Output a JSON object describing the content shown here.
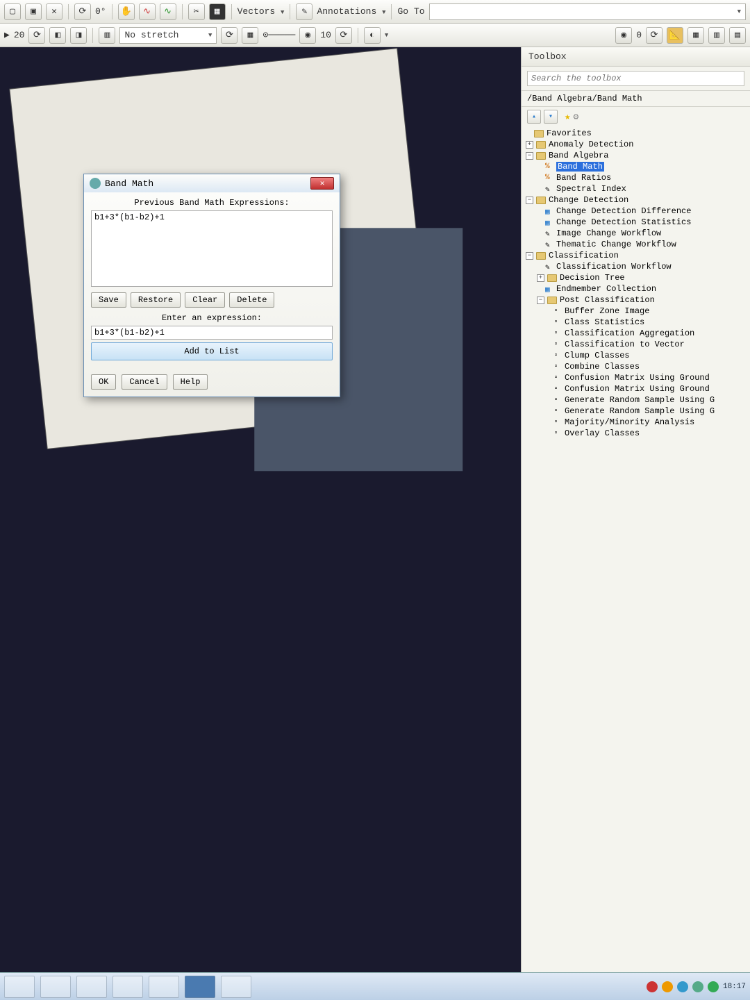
{
  "toolbar": {
    "rotation": "0°",
    "vectors": "Vectors",
    "annotations": "Annotations",
    "goto": "Go To",
    "zoom20": "20",
    "stretch": "No stretch",
    "value10": "10",
    "value0": "0"
  },
  "dialog": {
    "title": "Band Math",
    "label_prev": "Previous Band Math Expressions:",
    "expr_prev": "b1+3*(b1-b2)+1",
    "save": "Save",
    "restore": "Restore",
    "clear": "Clear",
    "delete": "Delete",
    "label_enter": "Enter an expression:",
    "expr_input": "b1+3*(b1-b2)+1",
    "add": "Add to List",
    "ok": "OK",
    "cancel": "Cancel",
    "help": "Help"
  },
  "sidebar": {
    "title": "Toolbox",
    "search_placeholder": "Search the toolbox",
    "path": "/Band Algebra/Band Math",
    "favorites": "Favorites",
    "anomaly": "Anomaly Detection",
    "band_algebra": "Band Algebra",
    "band_math": "Band Math",
    "band_ratios": "Band Ratios",
    "spectral_index": "Spectral Index",
    "change_detection": "Change Detection",
    "cdd": "Change Detection Difference",
    "cds": "Change Detection Statistics",
    "icw": "Image Change Workflow",
    "tcw": "Thematic Change Workflow",
    "classification": "Classification",
    "cw": "Classification Workflow",
    "dt": "Decision Tree",
    "ec": "Endmember Collection",
    "post": "Post Classification",
    "bzi": "Buffer Zone Image",
    "cs": "Class Statistics",
    "ca": "Classification Aggregation",
    "ctv": "Classification to Vector",
    "cc": "Clump Classes",
    "comb": "Combine Classes",
    "cmg1": "Confusion Matrix Using Ground",
    "cmg2": "Confusion Matrix Using Ground",
    "grs1": "Generate Random Sample Using G",
    "grs2": "Generate Random Sample Using G",
    "mma": "Majority/Minority Analysis",
    "oc": "Overlay Classes"
  },
  "clock": {
    "time": "18:17"
  }
}
